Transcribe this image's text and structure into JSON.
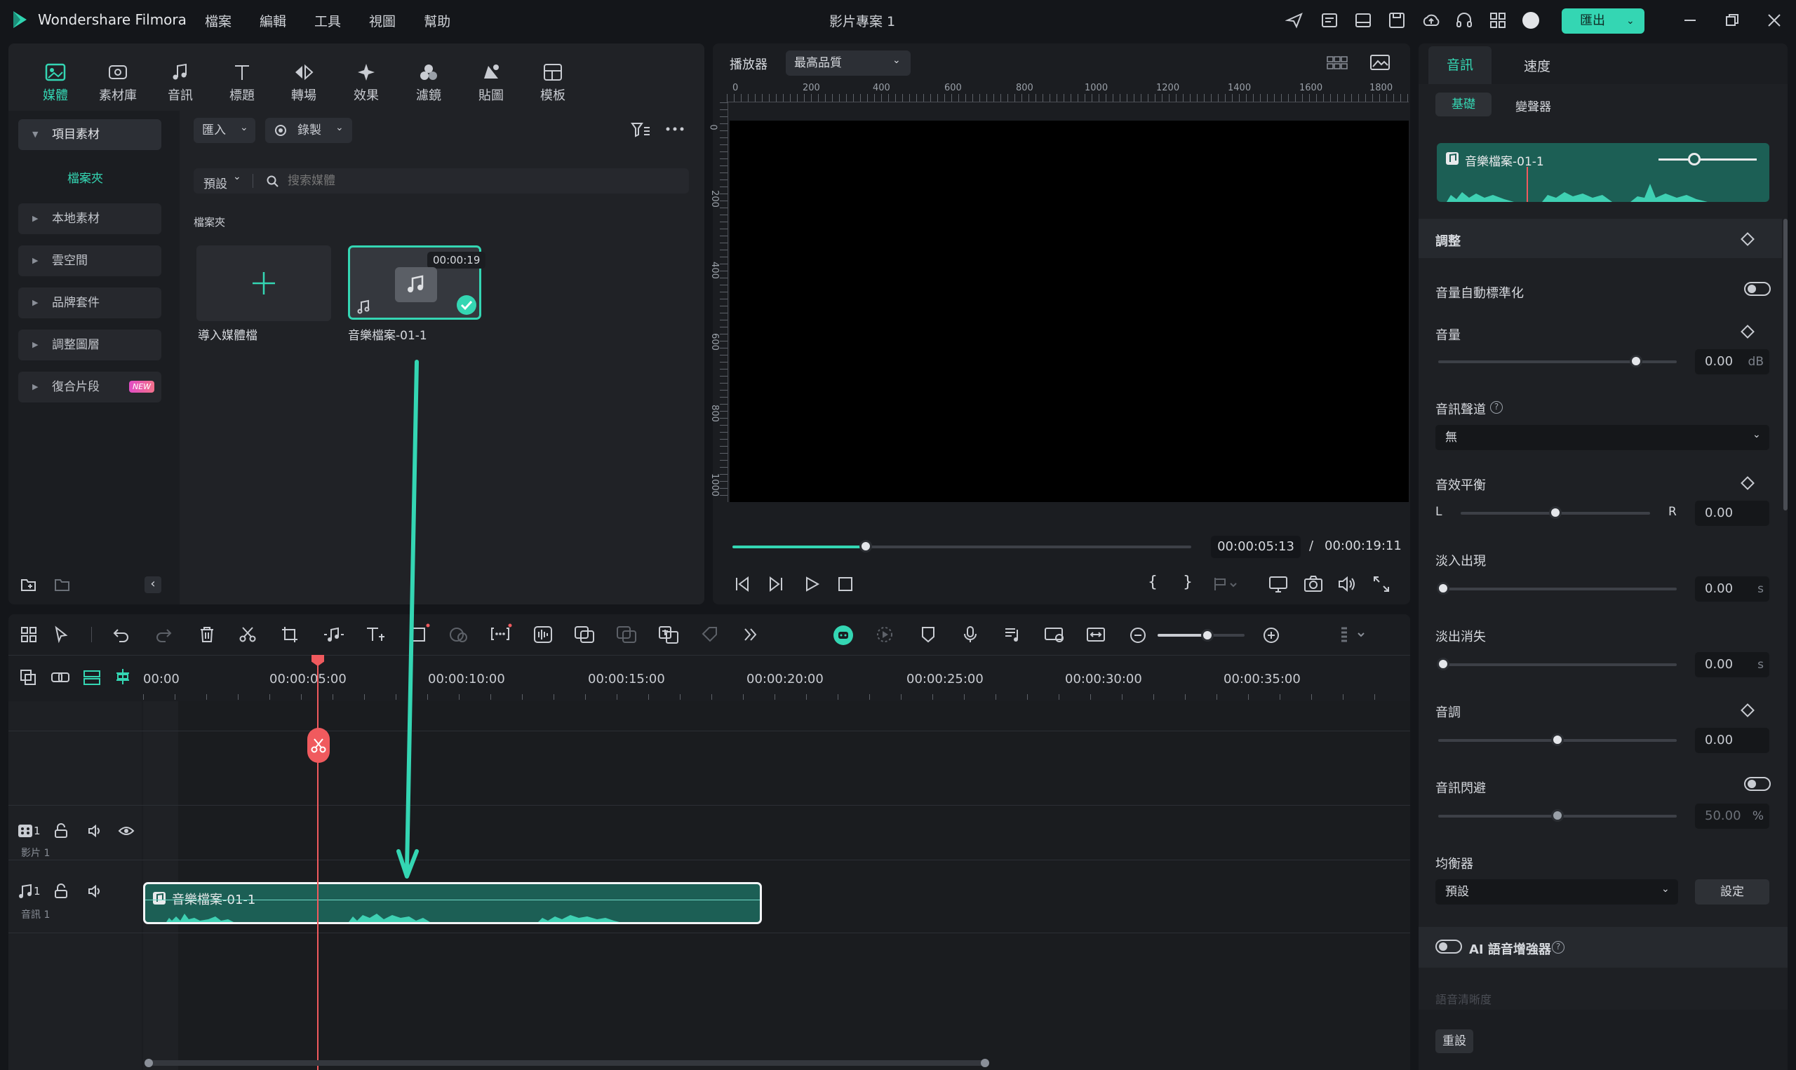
{
  "app": {
    "name": "Wondershare Filmora",
    "project_title": "影片專案 1",
    "export_label": "匯出"
  },
  "menu": [
    "檔案",
    "編輯",
    "工具",
    "視圖",
    "幫助"
  ],
  "media_nav": [
    "媒體",
    "素材庫",
    "音訊",
    "標題",
    "轉場",
    "效果",
    "濾鏡",
    "貼圖",
    "模板"
  ],
  "sidebar": {
    "items": [
      "項目素材",
      "檔案夾",
      "本地素材",
      "雲空間",
      "品牌套件",
      "調整圖層",
      "復合片段"
    ],
    "new_badge": "NEW"
  },
  "media_toolbar": {
    "import_label": "匯入",
    "record_label": "錄製",
    "sort_label": "預設",
    "search_placeholder": "搜索媒體"
  },
  "media_area": {
    "folder_title": "檔案夾",
    "import_tile_label": "導入媒體檔",
    "clip_duration": "00:00:19",
    "clip_name": "音樂檔案-01-1"
  },
  "player": {
    "label": "播放器",
    "quality": "最高品質",
    "ruler_h": [
      "0",
      "200",
      "400",
      "600",
      "800",
      "1000",
      "1200",
      "1400",
      "1600",
      "1800"
    ],
    "ruler_v": [
      "0",
      "200",
      "400",
      "600",
      "800",
      "1000"
    ],
    "current_time": "00:00:05:13",
    "separator": "/",
    "total_time": "00:00:19:11",
    "progress": 0.29
  },
  "timeline": {
    "ticks": [
      "00:00",
      "00:00:05:00",
      "00:00:10:00",
      "00:00:15:00",
      "00:00:20:00",
      "00:00:25:00",
      "00:00:30:00",
      "00:00:35:00"
    ],
    "video_track_label": "影片 1",
    "audio_track_label": "音訊 1",
    "track_number": "1",
    "audio_clip_name": "音樂檔案-01-1"
  },
  "right_panel": {
    "tabs": [
      "音訊",
      "速度"
    ],
    "subtabs": [
      "基礎",
      "變聲器"
    ],
    "preview_clip_name": "音樂檔案-01-1",
    "section_title": "調整",
    "auto_normalize_label": "音量自動標準化",
    "volume_label": "音量",
    "volume_value": "0.00",
    "volume_unit": "dB",
    "volume_level": 0.83,
    "channel_label": "音訊聲道",
    "channel_value": "無",
    "balance_label": "音效平衡",
    "balance_left": "L",
    "balance_right": "R",
    "balance_value": "0.00",
    "balance_level": 0.5,
    "fade_in_label": "淡入出現",
    "fade_in_value": "0.00",
    "fade_out_label": "淡出消失",
    "fade_out_value": "0.00",
    "seconds_unit": "s",
    "pitch_label": "音調",
    "pitch_value": "0.00",
    "pitch_level": 0.5,
    "ducking_label": "音訊閃避",
    "ducking_value": "50.00",
    "ducking_unit": "%",
    "ducking_level": 0.5,
    "equalizer_label": "均衡器",
    "equalizer_value": "預設",
    "equalizer_button": "設定",
    "ai_enhancer_label": "AI 語音增強器",
    "denoise_label": "語音清晰度",
    "reset_button": "重設"
  },
  "colors": {
    "accent": "#34d6b3",
    "playhead": "#f05a5e",
    "panel": "#202226",
    "bg": "#14161a"
  }
}
